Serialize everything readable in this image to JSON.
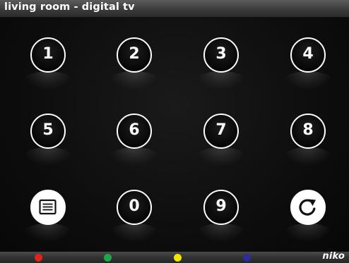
{
  "header": {
    "title": "living room - digital tv"
  },
  "keypad": {
    "keys": [
      {
        "id": "1",
        "label": "1"
      },
      {
        "id": "2",
        "label": "2"
      },
      {
        "id": "3",
        "label": "3"
      },
      {
        "id": "4",
        "label": "4"
      },
      {
        "id": "5",
        "label": "5"
      },
      {
        "id": "6",
        "label": "6"
      },
      {
        "id": "7",
        "label": "7"
      },
      {
        "id": "8",
        "label": "8"
      },
      {
        "id": "0",
        "label": "0"
      },
      {
        "id": "9",
        "label": "9"
      }
    ],
    "menu_icon": "list-menu-icon",
    "back_icon": "refresh-return-icon"
  },
  "footer": {
    "color_buttons": [
      {
        "name": "red",
        "color": "#e0241c"
      },
      {
        "name": "green",
        "color": "#1fa64a"
      },
      {
        "name": "yellow",
        "color": "#f2e600"
      },
      {
        "name": "blue",
        "color": "#2c2c9c"
      }
    ],
    "brand": "niko"
  },
  "colors": {
    "title_bar": "#3c3c3c",
    "background": "#0d0d0d",
    "key_ring": "#ffffff"
  }
}
